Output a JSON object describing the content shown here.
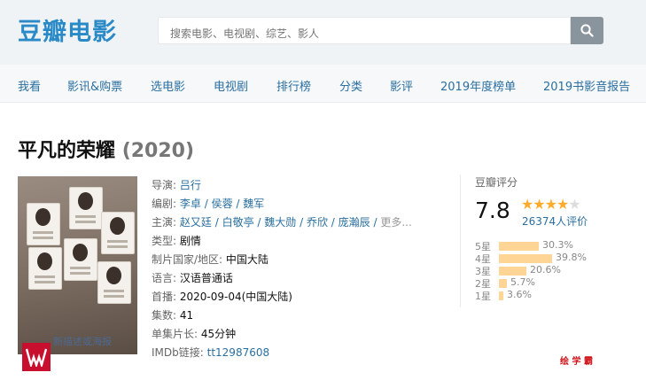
{
  "header": {
    "logo": "豆瓣电影",
    "search_placeholder": "搜索电影、电视剧、综艺、影人"
  },
  "nav": {
    "items": [
      "我看",
      "影讯&购票",
      "选电影",
      "电视剧",
      "排行榜",
      "分类",
      "影评",
      "2019年度榜单",
      "2019书影音报告"
    ]
  },
  "subject": {
    "title": "平凡的荣耀",
    "year": "(2020)",
    "poster_text": "平凡的荣耀",
    "poster_note": "新描述或海报",
    "director_label": "导演",
    "director": "吕行",
    "writer_label": "编剧",
    "writers": [
      "李卓",
      "侯蓉",
      "魏军"
    ],
    "cast_label": "主演",
    "cast": [
      "赵又廷",
      "白敬亭",
      "魏大勋",
      "乔欣",
      "庞瀚辰"
    ],
    "more_label": "更多...",
    "genre_label": "类型:",
    "genre": "剧情",
    "country_label": "制片国家/地区:",
    "country": "中国大陆",
    "language_label": "语言:",
    "language": "汉语普通话",
    "release_label": "首播:",
    "release": "2020-09-04(中国大陆)",
    "episodes_label": "集数:",
    "episodes": "41",
    "runtime_label": "单集片长:",
    "runtime": "45分钟",
    "imdb_label": "IMDb链接:",
    "imdb": "tt12987608"
  },
  "rating": {
    "title": "豆瓣评分",
    "score": "7.8",
    "stars_filled": 4,
    "stars_total": 5,
    "votes": "26374人评价",
    "breakdown": [
      {
        "label": "5星",
        "percent": 30.3,
        "text": "30.3%"
      },
      {
        "label": "4星",
        "percent": 39.8,
        "text": "39.8%"
      },
      {
        "label": "3星",
        "percent": 20.6,
        "text": "20.6%"
      },
      {
        "label": "2星",
        "percent": 5.7,
        "text": "5.7%"
      },
      {
        "label": "1星",
        "percent": 3.6,
        "text": "3.6%"
      }
    ]
  },
  "watermark": "绘 学 霸",
  "colors": {
    "link": "#2a6fa0",
    "brand": "#2a8ac8",
    "star": "#ffac2d",
    "bar": "#ffd596"
  },
  "icons": {
    "search": "search-icon",
    "brand_logo": "brand-logo-icon"
  }
}
